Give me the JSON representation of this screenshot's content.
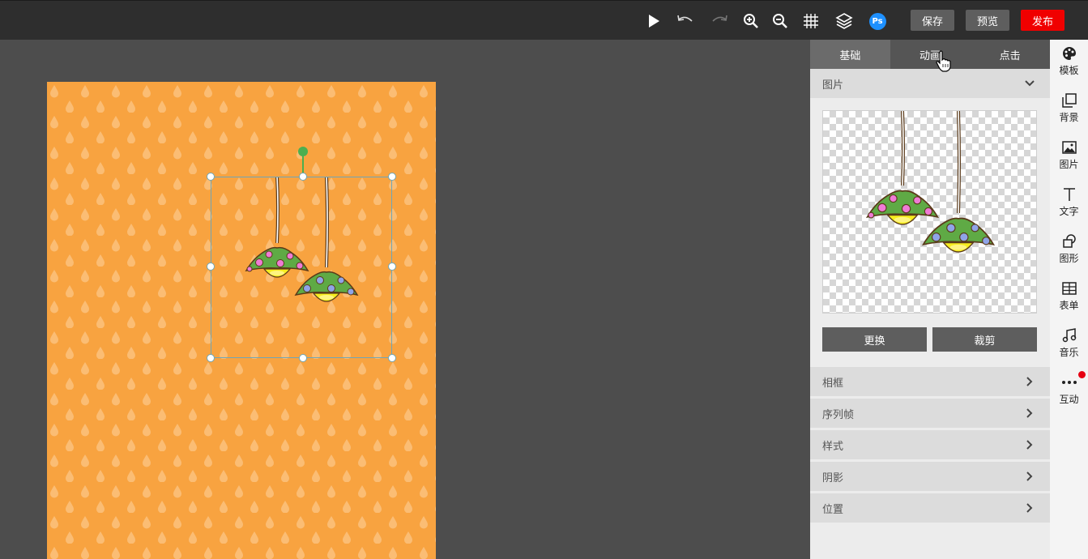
{
  "toolbar": {
    "icons": [
      "play-icon",
      "undo-icon",
      "redo-icon",
      "zoom-in-icon",
      "zoom-out-icon",
      "grid-icon",
      "layers-icon",
      "photoshop-icon"
    ],
    "ps_label": "Ps",
    "save_label": "保存",
    "preview_label": "预览",
    "publish_label": "发布",
    "accent_color": "#f00000"
  },
  "canvas": {
    "background_color": "#f8a340"
  },
  "panel": {
    "tabs": [
      {
        "label": "基础"
      },
      {
        "label": "动画"
      },
      {
        "label": "点击"
      }
    ],
    "image_section": {
      "title": "图片",
      "replace_label": "更换",
      "crop_label": "裁剪"
    },
    "sections": [
      {
        "label": "相框"
      },
      {
        "label": "序列帧"
      },
      {
        "label": "样式"
      },
      {
        "label": "阴影"
      },
      {
        "label": "位置"
      }
    ]
  },
  "sidebar": {
    "items": [
      {
        "label": "模板",
        "icon": "palette-icon"
      },
      {
        "label": "背景",
        "icon": "background-icon"
      },
      {
        "label": "图片",
        "icon": "image-icon"
      },
      {
        "label": "文字",
        "icon": "text-icon"
      },
      {
        "label": "图形",
        "icon": "shape-icon"
      },
      {
        "label": "表单",
        "icon": "table-icon"
      },
      {
        "label": "音乐",
        "icon": "music-icon"
      },
      {
        "label": "互动",
        "icon": "more-icon"
      }
    ]
  }
}
